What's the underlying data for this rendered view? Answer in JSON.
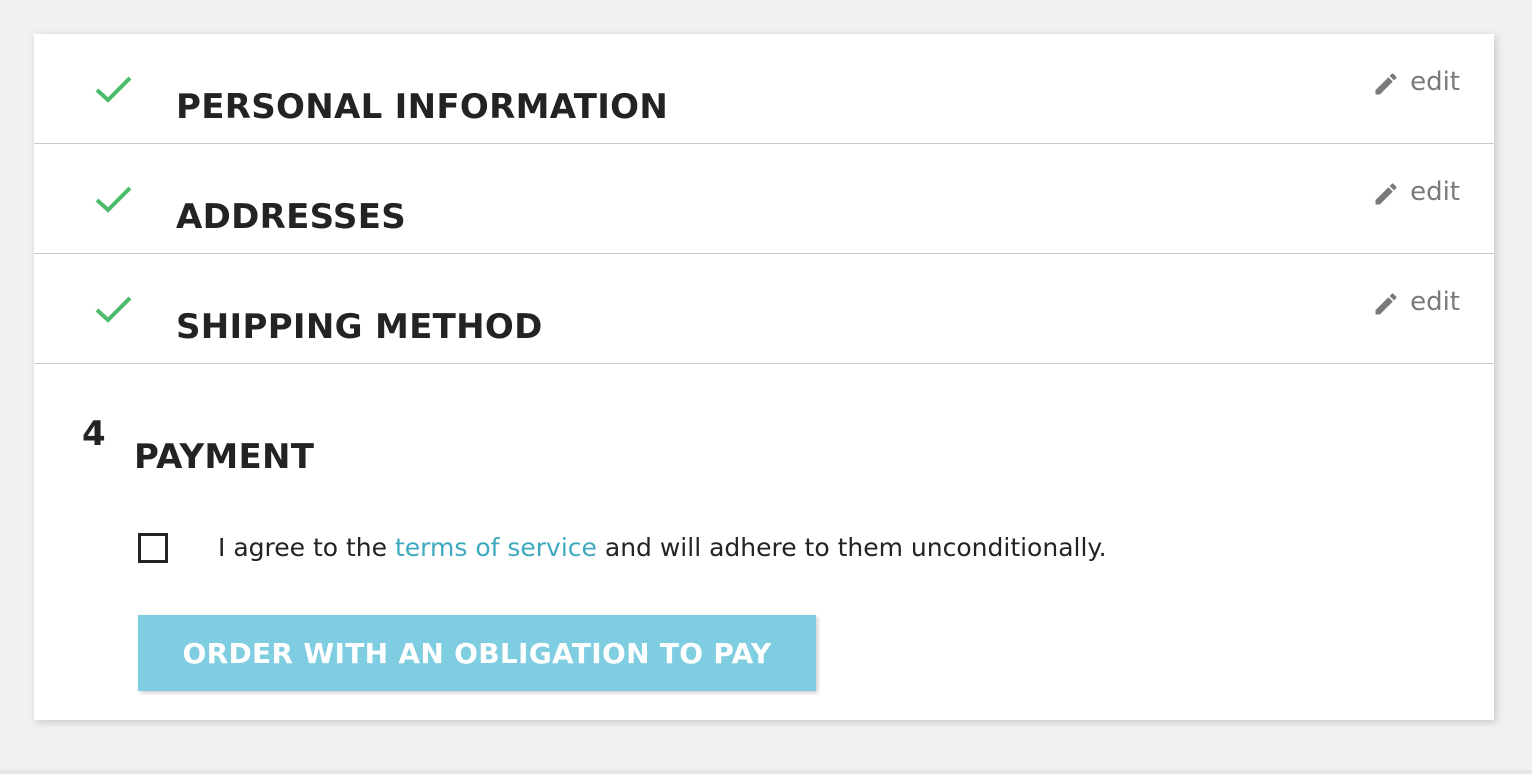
{
  "steps": [
    {
      "title": "PERSONAL INFORMATION",
      "status": "complete",
      "edit_label": "edit"
    },
    {
      "title": "ADDRESSES",
      "status": "complete",
      "edit_label": "edit"
    },
    {
      "title": "SHIPPING METHOD",
      "status": "complete",
      "edit_label": "edit"
    }
  ],
  "payment": {
    "number": "4",
    "title": "PAYMENT",
    "terms_before": "I agree to the ",
    "terms_link": "terms of service",
    "terms_after": " and will adhere to them unconditionally.",
    "terms_checked": false,
    "order_button_label": "ORDER WITH AN OBLIGATION TO PAY"
  },
  "colors": {
    "check_green": "#4cbb6c",
    "link": "#3ea9bf",
    "button_disabled": "#7fcde0",
    "edit_gray": "#7a7a7a"
  },
  "icons": {
    "complete": "check-icon",
    "edit": "pencil-icon"
  }
}
